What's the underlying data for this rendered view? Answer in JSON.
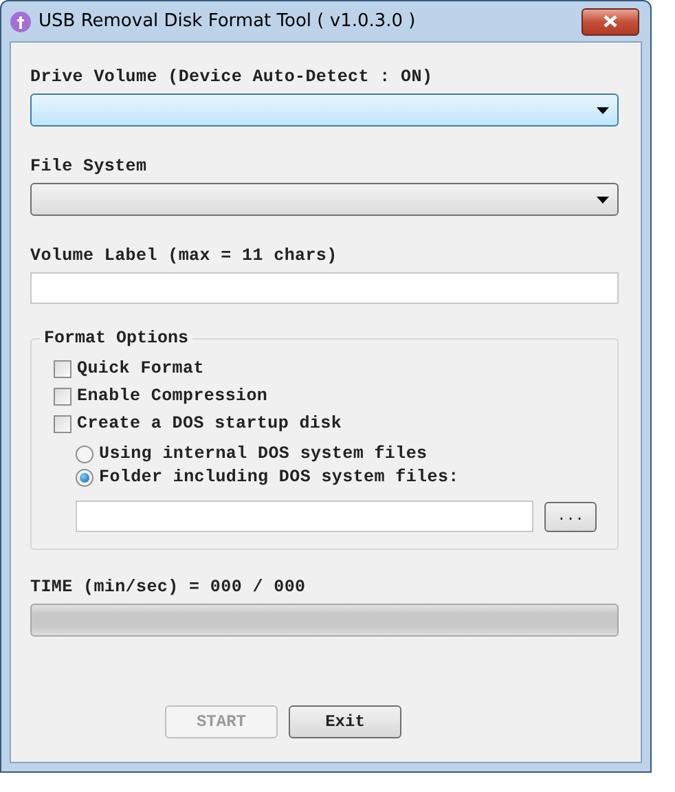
{
  "window": {
    "title": "USB Removal Disk Format Tool ( v1.0.3.0 )"
  },
  "drive_volume": {
    "label": "Drive Volume (Device Auto-Detect : ON)",
    "focused": true
  },
  "file_system": {
    "label": "File System",
    "focused": false
  },
  "volume_label": {
    "label": "Volume Label (max = 11 chars)"
  },
  "format_options": {
    "title": "Format Options",
    "checkboxes": [
      {
        "label": "Quick Format",
        "checked": false
      },
      {
        "label": "Enable Compression",
        "checked": false
      },
      {
        "label": "Create a DOS startup disk",
        "checked": false
      }
    ],
    "radios": [
      {
        "label": "Using internal DOS system files",
        "selected": false
      },
      {
        "label": "Folder including DOS system files:",
        "selected": true
      }
    ],
    "browse_button": "..."
  },
  "time": {
    "label": "TIME (min/sec) = 000 / 000",
    "level": 0
  },
  "buttons": [
    {
      "label": "START",
      "disabled": true
    },
    {
      "label": "Exit",
      "disabled": false
    }
  ]
}
